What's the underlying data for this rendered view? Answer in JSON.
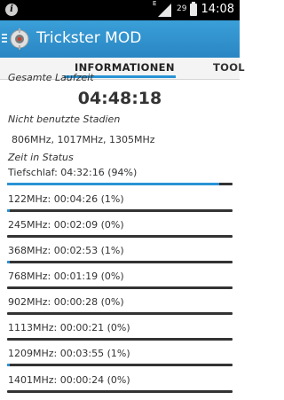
{
  "status_bar": {
    "network": "E",
    "battery_level": "29",
    "time": "14:08"
  },
  "action_bar": {
    "title": "Trickster MOD"
  },
  "tabs": [
    {
      "label": "INFORMATIONEN",
      "active": true
    },
    {
      "label": "TOOL",
      "active": false
    }
  ],
  "content": {
    "total_time_label": "Gesamte Laufzeit",
    "total_time": "04:48:18",
    "unused_states_label": "Nicht benutzte Stadien",
    "unused_states": "806MHz, 1017MHz, 1305MHz",
    "time_in_state_label": "Zeit in Status",
    "deep_sleep": {
      "label": "Tiefschlaf: 04:32:16 (94%)",
      "fraction": 0.94
    },
    "states": [
      {
        "label": "122MHz: 00:04:26 (1%)",
        "fraction": 0.01
      },
      {
        "label": "245MHz: 00:02:09 (0%)",
        "fraction": 0.0
      },
      {
        "label": "368MHz: 00:02:53 (1%)",
        "fraction": 0.01
      },
      {
        "label": "768MHz: 00:01:19 (0%)",
        "fraction": 0.0
      },
      {
        "label": "902MHz: 00:00:28 (0%)",
        "fraction": 0.0
      },
      {
        "label": "1113MHz: 00:00:21 (0%)",
        "fraction": 0.0
      },
      {
        "label": "1209MHz: 00:03:55 (1%)",
        "fraction": 0.01
      },
      {
        "label": "1401MHz: 00:00:24 (0%)",
        "fraction": 0.0
      }
    ]
  },
  "colors": {
    "accent": "#2a93d5",
    "action_bar": "#3397d3",
    "bar_track": "#333333"
  }
}
